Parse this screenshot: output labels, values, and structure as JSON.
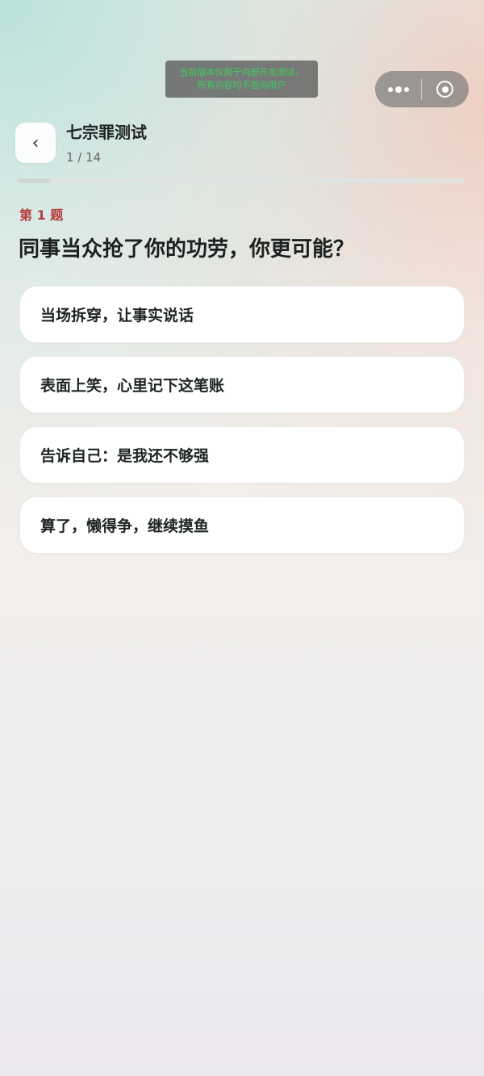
{
  "dev_notice": {
    "line1": "当前版本仅用于内部开发测试，",
    "line2": "所有内容均不面向用户"
  },
  "capsule": {
    "more_icon": "more-dots-icon",
    "close_icon": "target-ring-icon"
  },
  "header": {
    "back_icon": "chevron-left-icon",
    "back_glyph": "‹",
    "title": "七宗罪测试",
    "progress_text": "1 / 14",
    "progress_fraction": 0.0714
  },
  "question": {
    "number_label": "第 1 题",
    "text": "同事当众抢了你的功劳，你更可能？",
    "options": [
      "当场拆穿，让事实说话",
      "表面上笑，心里记下这笔账",
      "告诉自己：是我还不够强",
      "算了，懒得争，继续摸鱼"
    ]
  },
  "colors": {
    "accent_red": "#b33a3a",
    "notice_text": "#3dcf63"
  }
}
